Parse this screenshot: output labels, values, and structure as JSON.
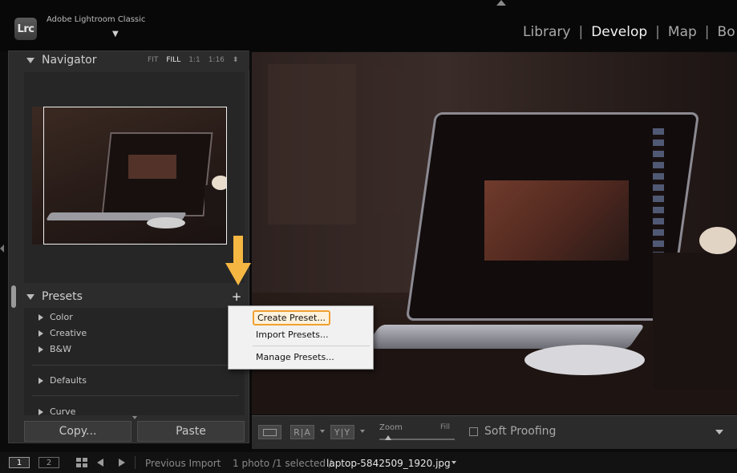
{
  "app": {
    "logo": "Lrc",
    "title": "Adobe Lightroom Classic",
    "title_caret": "▼"
  },
  "modules": {
    "items": [
      "Library",
      "Develop",
      "Map",
      "Bo"
    ],
    "active": "Develop",
    "separator": "|"
  },
  "navigator": {
    "title": "Navigator",
    "zoom_options": [
      "FIT",
      "FILL",
      "1:1",
      "1:16"
    ],
    "zoom_selected": "FILL",
    "zoom_more": "⬍"
  },
  "presets": {
    "title": "Presets",
    "add_icon": "+",
    "groups": [
      "Color",
      "Creative",
      "B&W",
      "Defaults",
      "Curve"
    ]
  },
  "context_menu": {
    "items": [
      "Create Preset...",
      "Import Presets...",
      "Manage Presets..."
    ],
    "highlighted": "Create Preset..."
  },
  "panel_buttons": {
    "copy": "Copy...",
    "paste": "Paste"
  },
  "toolbar": {
    "ra_label": "R|A",
    "yy_label": "Y|Y",
    "zoom_label": "Zoom",
    "zoom_value": "Fill",
    "soft_proofing_label": "Soft Proofing",
    "soft_proofing_checked": false
  },
  "filmstrip": {
    "screen_one": "1",
    "screen_two": "2",
    "source": "Previous Import",
    "count": "1 photo /1 selected /",
    "filename": "laptop-5842509_1920.jpg"
  },
  "colors": {
    "accent_arrow": "#f5b642",
    "menu_highlight_border": "#f0a030"
  }
}
